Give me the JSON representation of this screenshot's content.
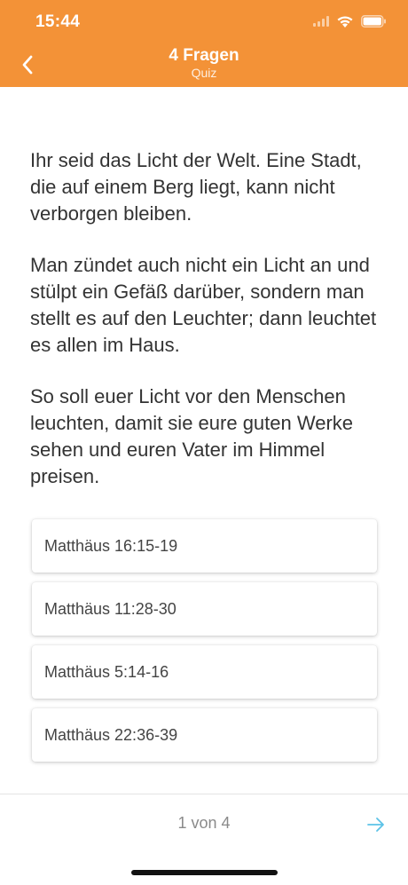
{
  "status_bar": {
    "time": "15:44"
  },
  "nav": {
    "title": "4 Fragen",
    "subtitle": "Quiz"
  },
  "question": {
    "paragraphs": [
      "Ihr seid das Licht der Welt. Eine Stadt, die auf einem Berg liegt, kann nicht verborgen bleiben.",
      "Man zündet auch nicht ein Licht an und stülpt ein Gefäß darüber, sondern man stellt es auf den Leuchter; dann leuchtet es allen im Haus.",
      "So soll euer Licht vor den Menschen leuchten, damit sie eure guten Werke sehen und euren Vater im Himmel preisen."
    ]
  },
  "answers": [
    "Matthäus 16:15-19",
    "Matthäus 11:28-30",
    "Matthäus 5:14-16",
    "Matthäus 22:36-39"
  ],
  "footer": {
    "page_indicator": "1 von 4"
  },
  "colors": {
    "header_bg": "#F39237",
    "next_arrow": "#5BC2E7"
  },
  "icons": {
    "back": "chevron-left-icon",
    "next": "arrow-right-icon",
    "wifi": "wifi-icon",
    "battery": "battery-icon"
  }
}
